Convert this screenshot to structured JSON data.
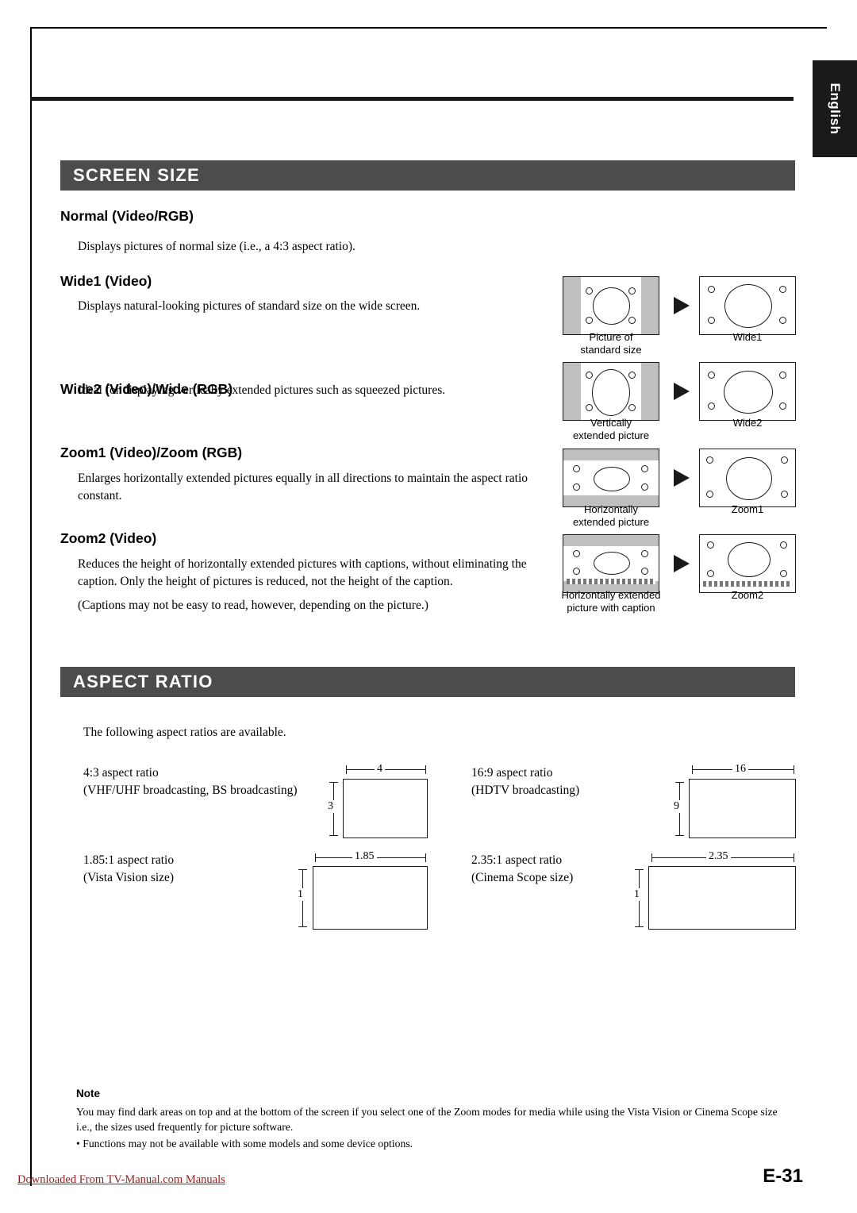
{
  "side_tab": {
    "label": "English"
  },
  "sections": {
    "screen_size": {
      "title": "SCREEN SIZE"
    },
    "aspect_ratio": {
      "title": "ASPECT RATIO"
    }
  },
  "screen_size_items": [
    {
      "heading": "Normal (Video/RGB)",
      "body": "Displays pictures of normal size (i.e., a 4:3 aspect ratio)."
    },
    {
      "heading": "Wide1 (Video)",
      "body": "Displays natural-looking pictures of standard size on the wide screen."
    },
    {
      "heading": "Wide2 (Video)/Wide (RGB)",
      "body": "Ideal for displaying vertically extended pictures such as squeezed pictures."
    },
    {
      "heading": "Zoom1 (Video)/Zoom (RGB)",
      "body": "Enlarges horizontally extended pictures equally in all directions to maintain the aspect ratio constant."
    },
    {
      "heading": "Zoom2 (Video)",
      "body": "Reduces the height of horizontally extended pictures with captions, without eliminating the caption.  Only the height of pictures is reduced, not the height of the caption.",
      "body2": "(Captions may not be easy to read, however, depending on the picture.)"
    }
  ],
  "illustrations": [
    {
      "source_caption": "Picture of\nstandard size",
      "result_caption": "Wide1"
    },
    {
      "source_caption": "Vertically\nextended picture",
      "result_caption": "Wide2"
    },
    {
      "source_caption": "Horizontally\nextended picture",
      "result_caption": "Zoom1"
    },
    {
      "source_caption": "Horizontally extended\npicture with caption",
      "result_caption": "Zoom2"
    }
  ],
  "illus_captions": {
    "src1_l1": "Picture of",
    "src1_l2": "standard size",
    "res1": "Wide1",
    "src2_l1": "Vertically",
    "src2_l2": "extended picture",
    "res2": "Wide2",
    "src3_l1": "Horizontally",
    "src3_l2": "extended picture",
    "res3": "Zoom1",
    "src4_l1": "Horizontally extended",
    "src4_l2": "picture with caption",
    "res4": "Zoom2"
  },
  "aspect_ratio": {
    "intro": "The following aspect ratios are available.",
    "items": [
      {
        "label_l1": "4:3 aspect ratio",
        "label_l2": "(VHF/UHF broadcasting, BS broadcasting)",
        "width_num": "4",
        "height_num": "3"
      },
      {
        "label_l1": "16:9 aspect ratio",
        "label_l2": "(HDTV broadcasting)",
        "width_num": "16",
        "height_num": "9"
      },
      {
        "label_l1": "1.85:1 aspect ratio",
        "label_l2": "(Vista Vision size)",
        "width_num": "1.85",
        "height_num": "1"
      },
      {
        "label_l1": "2.35:1 aspect ratio",
        "label_l2": "(Cinema Scope size)",
        "width_num": "2.35",
        "height_num": "1"
      }
    ]
  },
  "note": {
    "title": "Note",
    "body": "You may find dark areas on top and at the bottom of the screen if you select one of the Zoom modes for media while using the Vista Vision or Cinema Scope size i.e., the sizes used frequently for picture software.",
    "bullet": "•  Functions may not be available with some models and some device options."
  },
  "footer": {
    "link": "Downloaded From TV-Manual.com Manuals",
    "page": "E-31"
  }
}
